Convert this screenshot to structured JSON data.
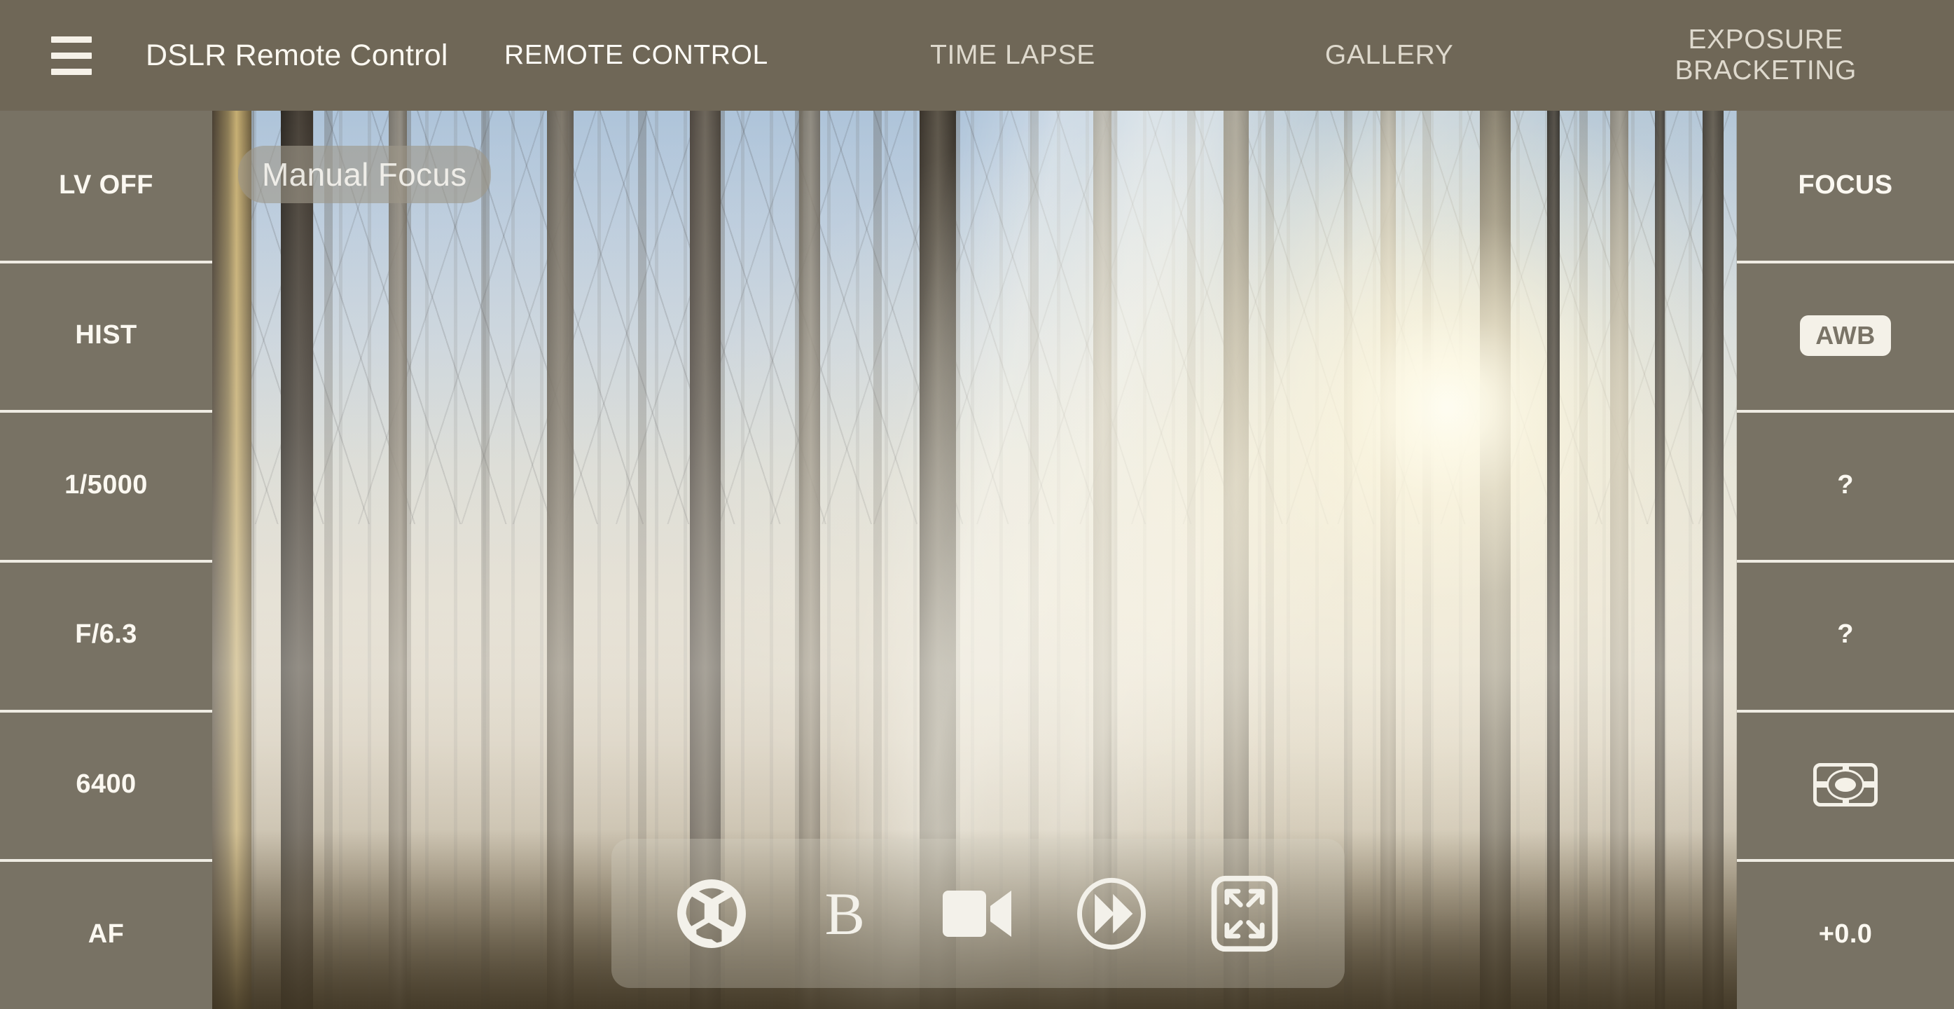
{
  "header": {
    "menu_icon": "hamburger-menu-icon",
    "title": "DSLR Remote Control",
    "tabs": [
      {
        "label": "REMOTE CONTROL",
        "active": true
      },
      {
        "label": "TIME LAPSE",
        "active": false
      },
      {
        "label": "GALLERY",
        "active": false
      },
      {
        "label": "EXPOSURE\nBRACKETING",
        "active": false
      }
    ]
  },
  "left_panel": {
    "items": [
      {
        "label": "LV OFF",
        "name": "liveview-toggle"
      },
      {
        "label": "HIST",
        "name": "histogram-toggle"
      },
      {
        "label": "1/5000",
        "name": "shutter-speed"
      },
      {
        "label": "F/6.3",
        "name": "aperture"
      },
      {
        "label": "6400",
        "name": "iso"
      },
      {
        "label": "AF",
        "name": "focus-mode"
      }
    ]
  },
  "right_panel": {
    "items": [
      {
        "label": "FOCUS",
        "name": "focus-button",
        "kind": "text"
      },
      {
        "label": "AWB",
        "name": "white-balance",
        "kind": "chip"
      },
      {
        "label": "?",
        "name": "picture-style",
        "kind": "text"
      },
      {
        "label": "?",
        "name": "drive-mode",
        "kind": "text"
      },
      {
        "label": "",
        "name": "metering-mode",
        "kind": "metering-icon"
      },
      {
        "label": "+0.0",
        "name": "exposure-compensation",
        "kind": "text"
      }
    ]
  },
  "liveview": {
    "focus_badge": "Manual Focus",
    "scene": "misty forest with sunbeams"
  },
  "toolbar": {
    "buttons": [
      {
        "name": "shutter-release-button",
        "icon": "aperture-icon",
        "label": ""
      },
      {
        "name": "bulb-mode-button",
        "icon": "bulb-icon",
        "label": "B"
      },
      {
        "name": "video-record-button",
        "icon": "video-camera-icon",
        "label": ""
      },
      {
        "name": "burst-mode-button",
        "icon": "fast-forward-icon",
        "label": ""
      },
      {
        "name": "fullscreen-button",
        "icon": "expand-icon",
        "label": ""
      }
    ]
  },
  "colors": {
    "header_bg": "#6f6757",
    "panel_bg": "#7a7467",
    "text_light": "#fbf8f1",
    "divider": "#efece3",
    "chip_bg": "#f4f1e8",
    "chip_text": "#7a7467"
  }
}
